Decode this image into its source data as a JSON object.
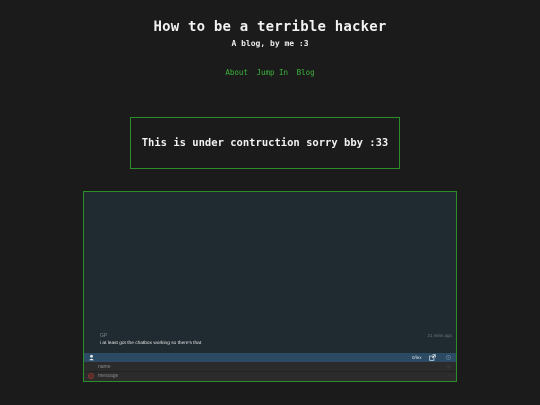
{
  "header": {
    "title": "How to be a terrible hacker",
    "subtitle": "A blog, by me :3"
  },
  "nav": {
    "items": [
      "About",
      "Jump In",
      "Blog"
    ]
  },
  "notice": {
    "text": "This is under contruction sorry bby :33"
  },
  "chatbox": {
    "message": {
      "author": "GP",
      "time": "21 mins ago",
      "text": "i at least got the chatbox working so there's that"
    },
    "bar": {
      "users_count": "0/lex"
    },
    "form": {
      "name_placeholder": "name",
      "message_placeholder": "message"
    }
  },
  "colors": {
    "background": "#1b1b1b",
    "accent_green": "#3db53d",
    "border_green": "#2a8f2a",
    "chat_bg": "#1f2a31",
    "chat_bar": "#2c4a63"
  }
}
